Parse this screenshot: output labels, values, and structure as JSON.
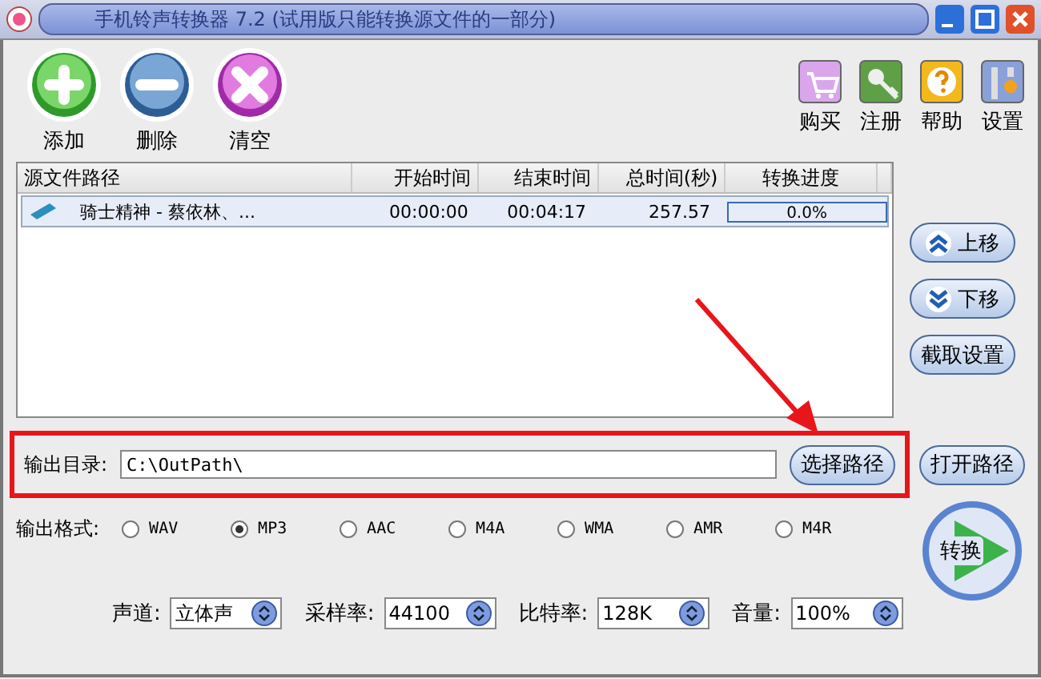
{
  "window": {
    "title": "手机铃声转换器 7.2 (试用版只能转换源文件的一部分)"
  },
  "toolbar_left": [
    {
      "label": "添加",
      "kind": "add"
    },
    {
      "label": "删除",
      "kind": "remove"
    },
    {
      "label": "清空",
      "kind": "clear"
    }
  ],
  "toolbar_right": [
    {
      "label": "购买",
      "kind": "cart"
    },
    {
      "label": "注册",
      "kind": "key"
    },
    {
      "label": "帮助",
      "kind": "help"
    },
    {
      "label": "设置",
      "kind": "tools"
    }
  ],
  "table": {
    "columns": [
      "源文件路径",
      "开始时间",
      "结束时间",
      "总时间(秒)",
      "转换进度"
    ],
    "rows": [
      {
        "name": "骑士精神 - 蔡依林、...",
        "start": "00:00:00",
        "end": "00:04:17",
        "total": "257.57",
        "progress": "0.0%",
        "selected": true
      }
    ]
  },
  "side_buttons": [
    {
      "label": "上移",
      "kind": "up"
    },
    {
      "label": "下移",
      "kind": "down"
    },
    {
      "label": "截取设置",
      "kind": "plain"
    }
  ],
  "output": {
    "label": "输出目录:",
    "value": "C:\\OutPath\\",
    "browse": "选择路径",
    "open": "打开路径"
  },
  "formats": {
    "label": "输出格式:",
    "options": [
      {
        "label": "WAV",
        "selected": false
      },
      {
        "label": "MP3",
        "selected": true
      },
      {
        "label": "AAC",
        "selected": false
      },
      {
        "label": "M4A",
        "selected": false
      },
      {
        "label": "WMA",
        "selected": false
      },
      {
        "label": "AMR",
        "selected": false
      },
      {
        "label": "M4R",
        "selected": false
      }
    ]
  },
  "convert": "转换",
  "settings": [
    {
      "label": "声道:",
      "value": "立体声"
    },
    {
      "label": "采样率:",
      "value": "44100"
    },
    {
      "label": "比特率:",
      "value": "128K"
    },
    {
      "label": "音量:",
      "value": "100%"
    }
  ]
}
